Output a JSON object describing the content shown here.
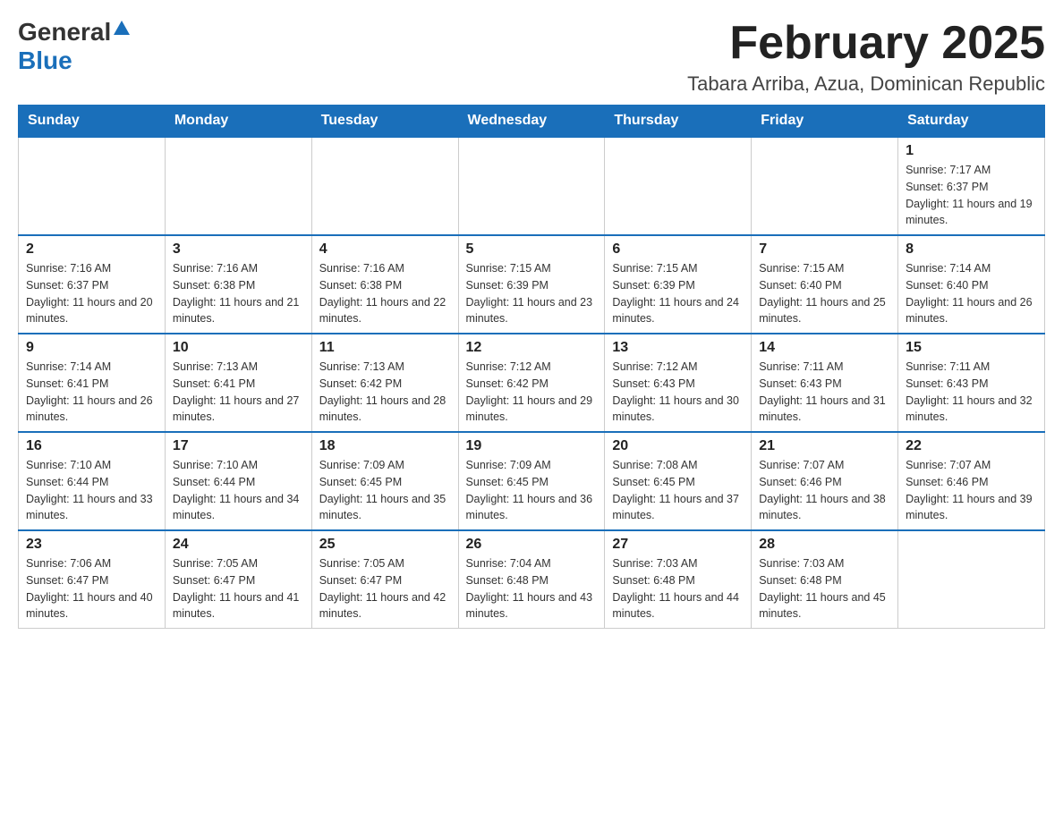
{
  "header": {
    "logo_general": "General",
    "logo_blue": "Blue",
    "month_title": "February 2025",
    "location": "Tabara Arriba, Azua, Dominican Republic"
  },
  "days_of_week": [
    "Sunday",
    "Monday",
    "Tuesday",
    "Wednesday",
    "Thursday",
    "Friday",
    "Saturday"
  ],
  "weeks": [
    [
      {
        "day": "",
        "info": ""
      },
      {
        "day": "",
        "info": ""
      },
      {
        "day": "",
        "info": ""
      },
      {
        "day": "",
        "info": ""
      },
      {
        "day": "",
        "info": ""
      },
      {
        "day": "",
        "info": ""
      },
      {
        "day": "1",
        "info": "Sunrise: 7:17 AM\nSunset: 6:37 PM\nDaylight: 11 hours and 19 minutes."
      }
    ],
    [
      {
        "day": "2",
        "info": "Sunrise: 7:16 AM\nSunset: 6:37 PM\nDaylight: 11 hours and 20 minutes."
      },
      {
        "day": "3",
        "info": "Sunrise: 7:16 AM\nSunset: 6:38 PM\nDaylight: 11 hours and 21 minutes."
      },
      {
        "day": "4",
        "info": "Sunrise: 7:16 AM\nSunset: 6:38 PM\nDaylight: 11 hours and 22 minutes."
      },
      {
        "day": "5",
        "info": "Sunrise: 7:15 AM\nSunset: 6:39 PM\nDaylight: 11 hours and 23 minutes."
      },
      {
        "day": "6",
        "info": "Sunrise: 7:15 AM\nSunset: 6:39 PM\nDaylight: 11 hours and 24 minutes."
      },
      {
        "day": "7",
        "info": "Sunrise: 7:15 AM\nSunset: 6:40 PM\nDaylight: 11 hours and 25 minutes."
      },
      {
        "day": "8",
        "info": "Sunrise: 7:14 AM\nSunset: 6:40 PM\nDaylight: 11 hours and 26 minutes."
      }
    ],
    [
      {
        "day": "9",
        "info": "Sunrise: 7:14 AM\nSunset: 6:41 PM\nDaylight: 11 hours and 26 minutes."
      },
      {
        "day": "10",
        "info": "Sunrise: 7:13 AM\nSunset: 6:41 PM\nDaylight: 11 hours and 27 minutes."
      },
      {
        "day": "11",
        "info": "Sunrise: 7:13 AM\nSunset: 6:42 PM\nDaylight: 11 hours and 28 minutes."
      },
      {
        "day": "12",
        "info": "Sunrise: 7:12 AM\nSunset: 6:42 PM\nDaylight: 11 hours and 29 minutes."
      },
      {
        "day": "13",
        "info": "Sunrise: 7:12 AM\nSunset: 6:43 PM\nDaylight: 11 hours and 30 minutes."
      },
      {
        "day": "14",
        "info": "Sunrise: 7:11 AM\nSunset: 6:43 PM\nDaylight: 11 hours and 31 minutes."
      },
      {
        "day": "15",
        "info": "Sunrise: 7:11 AM\nSunset: 6:43 PM\nDaylight: 11 hours and 32 minutes."
      }
    ],
    [
      {
        "day": "16",
        "info": "Sunrise: 7:10 AM\nSunset: 6:44 PM\nDaylight: 11 hours and 33 minutes."
      },
      {
        "day": "17",
        "info": "Sunrise: 7:10 AM\nSunset: 6:44 PM\nDaylight: 11 hours and 34 minutes."
      },
      {
        "day": "18",
        "info": "Sunrise: 7:09 AM\nSunset: 6:45 PM\nDaylight: 11 hours and 35 minutes."
      },
      {
        "day": "19",
        "info": "Sunrise: 7:09 AM\nSunset: 6:45 PM\nDaylight: 11 hours and 36 minutes."
      },
      {
        "day": "20",
        "info": "Sunrise: 7:08 AM\nSunset: 6:45 PM\nDaylight: 11 hours and 37 minutes."
      },
      {
        "day": "21",
        "info": "Sunrise: 7:07 AM\nSunset: 6:46 PM\nDaylight: 11 hours and 38 minutes."
      },
      {
        "day": "22",
        "info": "Sunrise: 7:07 AM\nSunset: 6:46 PM\nDaylight: 11 hours and 39 minutes."
      }
    ],
    [
      {
        "day": "23",
        "info": "Sunrise: 7:06 AM\nSunset: 6:47 PM\nDaylight: 11 hours and 40 minutes."
      },
      {
        "day": "24",
        "info": "Sunrise: 7:05 AM\nSunset: 6:47 PM\nDaylight: 11 hours and 41 minutes."
      },
      {
        "day": "25",
        "info": "Sunrise: 7:05 AM\nSunset: 6:47 PM\nDaylight: 11 hours and 42 minutes."
      },
      {
        "day": "26",
        "info": "Sunrise: 7:04 AM\nSunset: 6:48 PM\nDaylight: 11 hours and 43 minutes."
      },
      {
        "day": "27",
        "info": "Sunrise: 7:03 AM\nSunset: 6:48 PM\nDaylight: 11 hours and 44 minutes."
      },
      {
        "day": "28",
        "info": "Sunrise: 7:03 AM\nSunset: 6:48 PM\nDaylight: 11 hours and 45 minutes."
      },
      {
        "day": "",
        "info": ""
      }
    ]
  ]
}
